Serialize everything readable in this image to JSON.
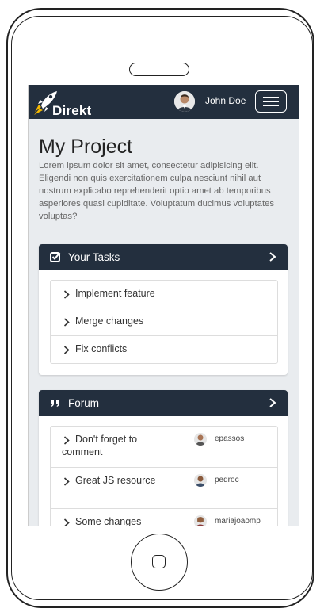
{
  "navbar": {
    "brand": "Direkt",
    "user_name": "John Doe",
    "icons": {
      "brand": "rocket-logo",
      "avatar": "user-avatar",
      "menu": "hamburger-menu-icon"
    }
  },
  "page": {
    "title": "My Project",
    "description": "Lorem ipsum dolor sit amet, consectetur adipisicing elit. Eligendi non quis exercitationem culpa nesciunt nihil aut nostrum explicabo reprehenderit optio amet ab temporibus asperiores quasi cupiditate. Voluptatum ducimus voluptates voluptas?"
  },
  "tasks_card": {
    "title": "Your Tasks",
    "icon": "check-square-icon",
    "items": [
      {
        "label": "Implement feature"
      },
      {
        "label": "Merge changes"
      },
      {
        "label": "Fix conflicts"
      }
    ]
  },
  "forum_card": {
    "title": "Forum",
    "icon": "quote-icon",
    "items": [
      {
        "title": "Don't forget to comment",
        "user": "epassos"
      },
      {
        "title": "Great JS resource",
        "user": "pedroc"
      },
      {
        "title": "Some changes",
        "user": "mariajoaomp"
      }
    ]
  },
  "colors": {
    "navbar": "#232f3e",
    "background": "#e9ecef",
    "text": "#222222",
    "muted": "#666666"
  }
}
